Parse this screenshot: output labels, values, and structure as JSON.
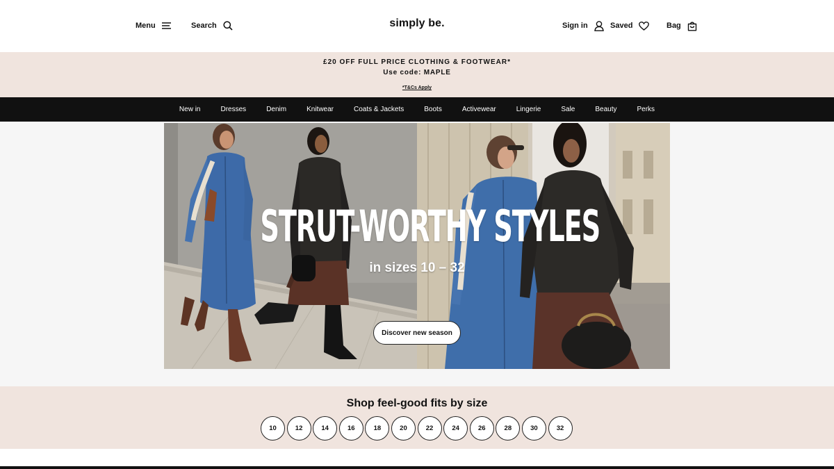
{
  "header": {
    "menu_label": "Menu",
    "search_label": "Search",
    "logo_text": "simply be.",
    "signin_label": "Sign in",
    "saved_label": "Saved",
    "bag_label": "Bag"
  },
  "promo": {
    "line1": "£20 OFF FULL PRICE CLOTHING & FOOTWEAR*",
    "line2": "Use code: MAPLE",
    "terms": "*T&Cs Apply"
  },
  "nav": {
    "items": [
      "New in",
      "Dresses",
      "Denim",
      "Knitwear",
      "Coats & Jackets",
      "Boots",
      "Activewear",
      "Lingerie",
      "Sale",
      "Beauty",
      "Perks"
    ]
  },
  "hero": {
    "title": "STRUT-WORTHY STYLES",
    "subtitle": "in sizes 10 – 32",
    "cta": "Discover new season"
  },
  "sizes": {
    "title": "Shop feel-good fits by size",
    "values": [
      "10",
      "12",
      "14",
      "16",
      "18",
      "20",
      "22",
      "24",
      "26",
      "28",
      "30",
      "32"
    ]
  },
  "colors": {
    "promo_bg": "#f0e4de",
    "nav_bg": "#111111",
    "page_bg": "#ffffff"
  }
}
